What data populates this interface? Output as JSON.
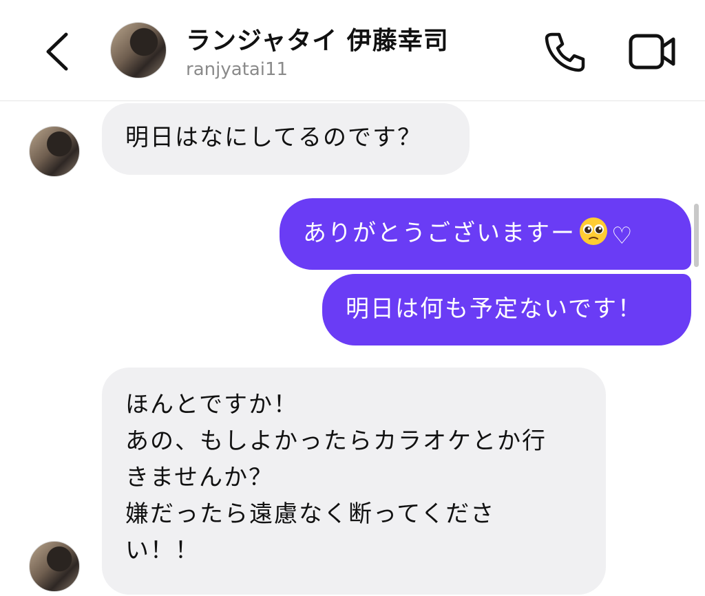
{
  "header": {
    "name": "ランジャタイ 伊藤幸司",
    "username": "ranjyatai11"
  },
  "messages": [
    {
      "direction": "incoming",
      "text": "明日はなにしてるのです？"
    },
    {
      "direction": "outgoing",
      "text": "ありがとうございますー",
      "emoji": "pleading-face-emoji",
      "suffix": "♡"
    },
    {
      "direction": "outgoing",
      "text": "明日は何も予定ないです！"
    },
    {
      "direction": "incoming",
      "lines": [
        "ほんとですか！",
        "あの、もしよかったらカラオケとか行",
        "きませんか？",
        "嫌だったら遠慮なく断ってくださ",
        "い！！"
      ]
    }
  ],
  "colors": {
    "outgoing_bubble": "#6a3cf5",
    "incoming_bubble": "#f0f0f2",
    "username": "#8a8a8a"
  },
  "icons": [
    "back-chevron-icon",
    "phone-icon",
    "video-camera-icon"
  ]
}
